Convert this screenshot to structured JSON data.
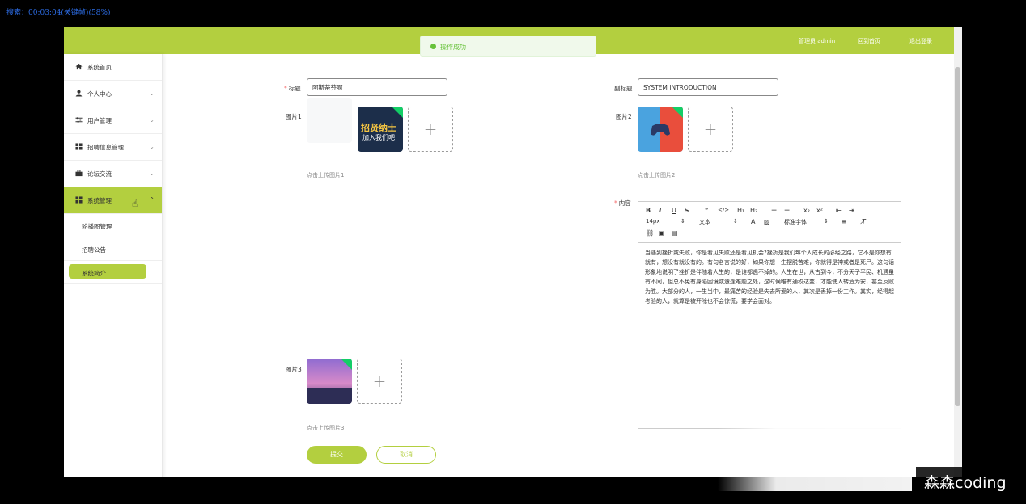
{
  "search_status": "搜索：00:03:04(关键帧)(58%)",
  "topbar": {
    "admin_label": "管理员 admin",
    "home_link": "回到首页",
    "logout_link": "退出登录"
  },
  "toast": {
    "message": "操作成功"
  },
  "sidebar": {
    "items": [
      {
        "label": "系统首页",
        "icon": "home-icon"
      },
      {
        "label": "个人中心",
        "icon": "user-icon"
      },
      {
        "label": "用户管理",
        "icon": "sliders-icon"
      },
      {
        "label": "招聘信息管理",
        "icon": "grid-icon"
      },
      {
        "label": "论坛交流",
        "icon": "briefcase-icon"
      },
      {
        "label": "系统管理",
        "icon": "grid-icon"
      }
    ],
    "sub_items": [
      {
        "label": "轮播图管理"
      },
      {
        "label": "招聘公告"
      },
      {
        "label": "系统简介"
      }
    ]
  },
  "form": {
    "title_label": "标题",
    "title_value": "阿斯蒂芬啊",
    "subtitle_label": "副标题",
    "subtitle_value": "SYSTEM INTRODUCTION",
    "pic1_label": "图片1",
    "pic1_hint": "点击上传图片1",
    "pic2_label": "图片2",
    "pic2_hint": "点击上传图片2",
    "pic3_label": "图片3",
    "pic3_hint": "点击上传图片3",
    "content_label": "内容",
    "pic1_thumb_text_1": "招贤纳士",
    "pic1_thumb_text_2": "加入我们吧",
    "submit_label": "提交",
    "cancel_label": "取消"
  },
  "editor": {
    "font_size": "14px",
    "paragraph": "文本",
    "font_family": "标准字体",
    "content": "当遇到挫折或失败，你是看见失败还是看见机会?挫折是我们每个人成长的必经之路，它不是你想有就有，想没有就没有的。有句名言说的好，如果你想一生摆脱苦难，你就得是神或者是死尸。这句话形象地说明了挫折是伴随着人生的，是谁都逃不掉的。人生在世，从古到今，不分天子平民、机遇虽有不同，但总不免有身陷困境或遭逢难题之处，这时候唯有通权达变，才能使人转危为安，甚至反败为胜。大部分的人，一生当中，最痛苦的经验是失去所爱的人，其次是丢掉一份工作。其实，经得起考验的人，就算是被开除也不会惊慌，要学会面对。"
  },
  "watermark": "森森coding",
  "colors": {
    "accent": "#b3cf3f",
    "success": "#67c23a"
  }
}
